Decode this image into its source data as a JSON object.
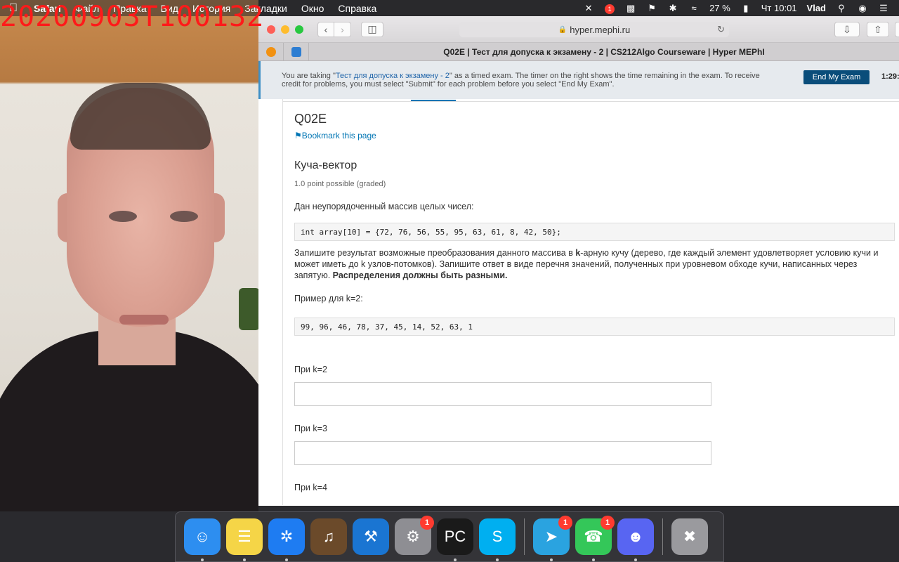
{
  "webcam": {
    "timestamp": "20200903T100132"
  },
  "menubar": {
    "apple_icon": "apple-icon",
    "items": [
      "Safari",
      "Файл",
      "Правка",
      "Вид",
      "История",
      "Закладки",
      "Окно",
      "Справка"
    ],
    "battery": "27 %",
    "clock": "Чт 10:01",
    "user": "Vlad",
    "notification_badge": "1"
  },
  "browser": {
    "url": "hyper.mephi.ru",
    "tab_title": "Q02E | Тест для допуска к экзамену - 2 | CS212Algo Courseware | Hyper MEPhI"
  },
  "exam_banner": {
    "text_before": "You are taking \"",
    "exam_link": "Тест для допуска к экзамену - 2",
    "text_after": "\" as a timed exam. The timer on the right shows the time remaining in the exam. To receive credit for problems, you must select \"Submit\" for each problem before you select \"End My Exam\".",
    "end_button": "End My Exam",
    "timer": "1:29:"
  },
  "problem": {
    "unit_title": "Q02E",
    "bookmark": "Bookmark this page",
    "title": "Куча-вектор",
    "points": "1.0 point possible (graded)",
    "intro": "Дан неупорядоченный массив целых чисел:",
    "array_code": "int array[10] = {72, 76, 56, 55, 95, 63, 61, 8, 42, 50};",
    "task_part1": "Запишите результат возможные преобразования данного массива в ",
    "task_bold_k": "k",
    "task_part2": "-арную кучу (дерево, где каждый элемент удовлетворяет условию кучи и может иметь до k узлов-потомков). Запишите ответ в виде перечня значений, полученных при уровневом обходе кучи, написанных через запятую. ",
    "task_bold_end": "Распределения должны быть разными.",
    "example_label": "Пример для k=2:",
    "example_code": "99, 96, 46, 78, 37, 45, 14, 52, 63, 1",
    "k2_label": "При k=2",
    "k3_label": "При k=3",
    "k4_label": "При k=4",
    "k2_value": "",
    "k3_value": ""
  },
  "dock": {
    "apps": [
      {
        "name": "Finder",
        "icon": "finder-icon",
        "color": "#2d8ef0",
        "running": true
      },
      {
        "name": "Notes",
        "icon": "notes-icon",
        "color": "#f5d547",
        "running": true
      },
      {
        "name": "Safari",
        "icon": "safari-icon",
        "color": "#1e7cf2",
        "running": true
      },
      {
        "name": "GarageBand",
        "icon": "garageband-icon",
        "color": "#6b4a2a",
        "running": false
      },
      {
        "name": "Xcode",
        "icon": "xcode-icon",
        "color": "#1a75d2",
        "running": false
      },
      {
        "name": "System Preferences",
        "icon": "gear-icon",
        "color": "#8e8e93",
        "running": false,
        "badge": "1"
      },
      {
        "name": "PyCharm",
        "icon": "pycharm-icon",
        "color": "#1a1a1a",
        "running": true
      },
      {
        "name": "Skype",
        "icon": "skype-icon",
        "color": "#00aff0",
        "running": true
      },
      {
        "name": "Telegram",
        "icon": "telegram-icon",
        "color": "#2aa3e0",
        "running": true,
        "badge": "1"
      },
      {
        "name": "FaceTime",
        "icon": "facetime-icon",
        "color": "#34c759",
        "running": true,
        "badge": "1"
      },
      {
        "name": "Discord",
        "icon": "discord-icon",
        "color": "#5865f2",
        "running": true
      },
      {
        "name": "Trash",
        "icon": "trash-icon",
        "color": "#9a9a9e",
        "running": false
      }
    ]
  }
}
